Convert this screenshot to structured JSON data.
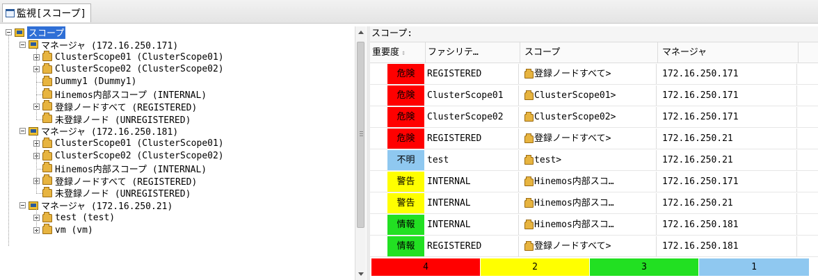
{
  "view": {
    "title": "監視[スコープ]"
  },
  "tree": {
    "root": {
      "label": "スコープ"
    },
    "managers": [
      {
        "label": "マネージャ (172.16.250.171)",
        "children": [
          {
            "label": "ClusterScope01 (ClusterScope01)",
            "expandable": true
          },
          {
            "label": "ClusterScope02 (ClusterScope02)",
            "expandable": true
          },
          {
            "label": "Dummy1 (Dummy1)",
            "expandable": false
          },
          {
            "label": "Hinemos内部スコープ (INTERNAL)",
            "expandable": false
          },
          {
            "label": "登録ノードすべて (REGISTERED)",
            "expandable": true
          },
          {
            "label": "未登録ノード (UNREGISTERED)",
            "expandable": false
          }
        ]
      },
      {
        "label": "マネージャ (172.16.250.181)",
        "children": [
          {
            "label": "ClusterScope01 (ClusterScope01)",
            "expandable": true
          },
          {
            "label": "ClusterScope02 (ClusterScope02)",
            "expandable": true
          },
          {
            "label": "Hinemos内部スコープ (INTERNAL)",
            "expandable": false
          },
          {
            "label": "登録ノードすべて (REGISTERED)",
            "expandable": true
          },
          {
            "label": "未登録ノード (UNREGISTERED)",
            "expandable": false
          }
        ]
      },
      {
        "label": "マネージャ (172.16.250.21)",
        "children": [
          {
            "label": "test (test)",
            "expandable": true
          },
          {
            "label": "vm (vm)",
            "expandable": true
          }
        ]
      }
    ]
  },
  "list": {
    "scope_label": "スコープ:",
    "columns": {
      "severity": "重要度",
      "facility": "ファシリテ…",
      "scope": "スコープ",
      "manager": "マネージャ"
    },
    "rows": [
      {
        "severity": "危険",
        "severity_color": "#ff0000",
        "facility": "REGISTERED",
        "scope": "登録ノードすべて>",
        "manager": "172.16.250.171"
      },
      {
        "severity": "危険",
        "severity_color": "#ff0000",
        "facility": "ClusterScope01",
        "scope": "ClusterScope01>",
        "manager": "172.16.250.171"
      },
      {
        "severity": "危険",
        "severity_color": "#ff0000",
        "facility": "ClusterScope02",
        "scope": "ClusterScope02>",
        "manager": "172.16.250.171"
      },
      {
        "severity": "危険",
        "severity_color": "#ff0000",
        "facility": "REGISTERED",
        "scope": "登録ノードすべて>",
        "manager": "172.16.250.21"
      },
      {
        "severity": "不明",
        "severity_color": "#8fc8f0",
        "facility": "test",
        "scope": "test>",
        "manager": "172.16.250.21"
      },
      {
        "severity": "警告",
        "severity_color": "#ffff00",
        "facility": "INTERNAL",
        "scope": "Hinemos内部スコ…",
        "manager": "172.16.250.171"
      },
      {
        "severity": "警告",
        "severity_color": "#ffff00",
        "facility": "INTERNAL",
        "scope": "Hinemos内部スコ…",
        "manager": "172.16.250.21"
      },
      {
        "severity": "情報",
        "severity_color": "#22e022",
        "facility": "INTERNAL",
        "scope": "Hinemos内部スコ…",
        "manager": "172.16.250.181"
      },
      {
        "severity": "情報",
        "severity_color": "#22e022",
        "facility": "REGISTERED",
        "scope": "登録ノードすべて>",
        "manager": "172.16.250.181"
      }
    ],
    "summary": [
      {
        "count": "4",
        "color": "#ff0000"
      },
      {
        "count": "2",
        "color": "#ffff00"
      },
      {
        "count": "3",
        "color": "#22e022"
      },
      {
        "count": "1",
        "color": "#8fc8f0"
      }
    ]
  }
}
